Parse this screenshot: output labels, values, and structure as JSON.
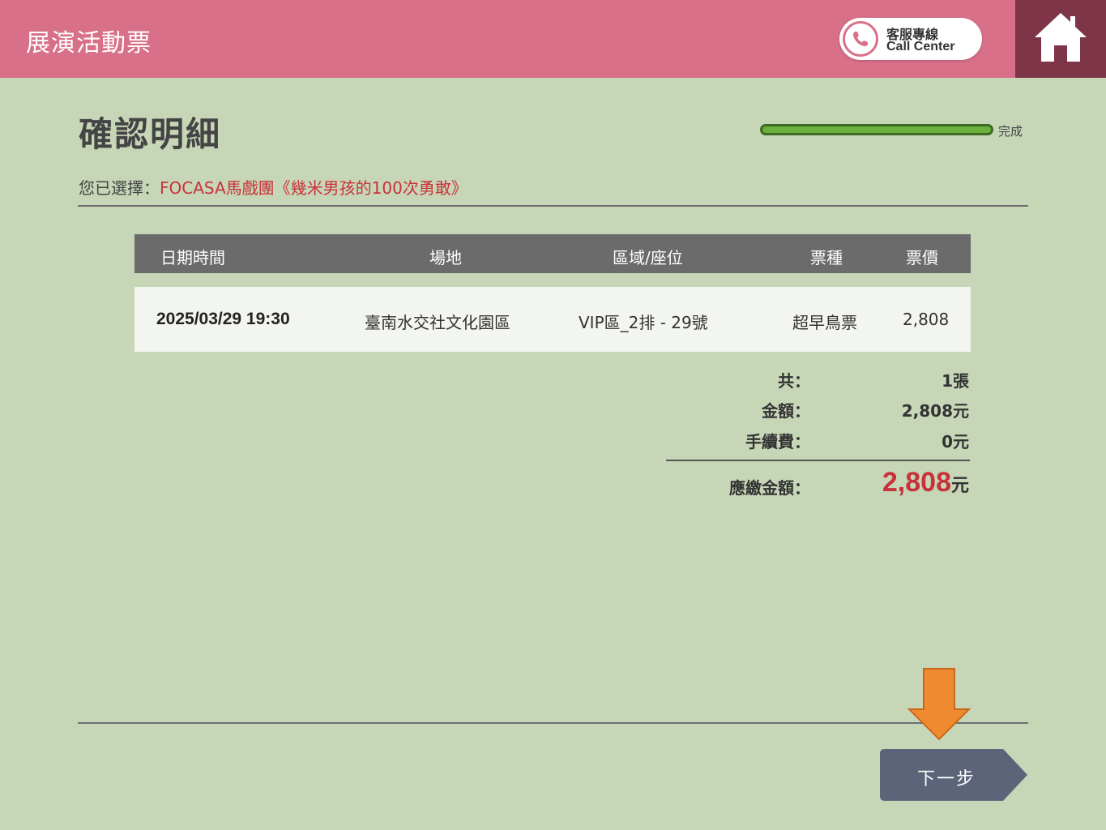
{
  "header": {
    "title": "展演活動票",
    "call_center_zh": "客服專線",
    "call_center_en": "Call Center"
  },
  "page": {
    "title": "確認明細",
    "progress_label": "完成",
    "progress_fraction": 1.0
  },
  "selection": {
    "prefix": "您已選擇：",
    "event": "FOCASA馬戲團《幾米男孩的100次勇敢》"
  },
  "table": {
    "headers": [
      "日期時間",
      "場地",
      "區域/座位",
      "票種",
      "票價"
    ],
    "rows": [
      [
        "2025/03/29 19:30",
        "臺南水交社文化園區",
        "VIP區_2排 - 29號",
        "超早鳥票",
        "2,808"
      ]
    ]
  },
  "summary": {
    "count_label": "共：",
    "count_value": "1張",
    "amount_label": "金額：",
    "amount_value": "2,808元",
    "fee_label": "手續費：",
    "fee_value": "0元",
    "total_label": "應繳金額：",
    "total_value": "2,808",
    "total_unit": "元"
  },
  "actions": {
    "next_label": "下一步"
  },
  "colors": {
    "header": "#d87089",
    "home": "#7d3547",
    "background": "#c6d6b7",
    "accent_red": "#c8323b",
    "progress": "#6bb03a",
    "button": "#5b6478",
    "arrow": "#f08a30"
  }
}
